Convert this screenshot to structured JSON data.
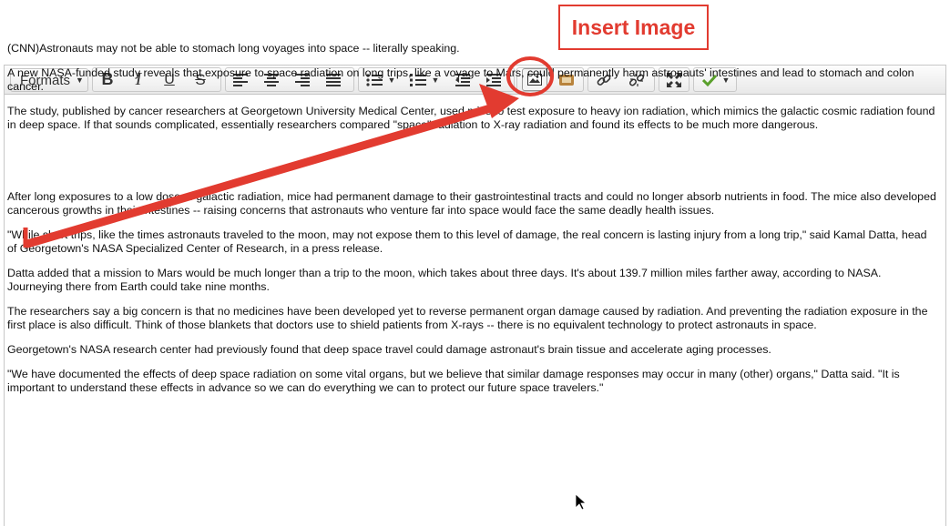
{
  "callout": {
    "label": "Insert Image"
  },
  "toolbar": {
    "formats_label": "Formats",
    "bold_label": "B",
    "italic_label": "I",
    "underline_label": "U",
    "strike_label": "S",
    "icons": [
      "align-left-icon",
      "align-center-icon",
      "align-right-icon",
      "align-justify-icon",
      "bullet-list-icon",
      "numbered-list-icon",
      "outdent-icon",
      "indent-icon",
      "insert-image-icon",
      "insert-media-icon",
      "link-icon",
      "unlink-icon",
      "fullscreen-icon",
      "check-icon"
    ]
  },
  "content": {
    "paragraphs": [
      "(CNN)Astronauts may not be able to stomach long voyages into space -- literally speaking.",
      "A new NASA-funded study reveals that exposure to space radiation on long trips, like a voyage to Mars, could permanently harm astronauts' intestines and lead to stomach and colon cancer.",
      "The study, published by cancer researchers at Georgetown University Medical Center, used mice to test exposure to heavy ion radiation, which mimics the galactic cosmic radiation found in deep space. If that sounds complicated, essentially researchers compared \"space\" radiation to X-ray radiation and found its effects to be much more dangerous.",
      "After long exposures to a low dose of galactic radiation, mice had permanent damage to their gastrointestinal tracts and could no longer absorb nutrients in food. The mice also developed cancerous growths in their intestines -- raising concerns that astronauts who venture far into space would face the same deadly health issues.",
      "\"While short trips, like the times astronauts traveled to the moon, may not expose them to this level of damage, the real concern is lasting injury from a long trip,\" said Kamal Datta, head of Georgetown's NASA Specialized Center of Research, in a press release.",
      "Datta added that a mission to Mars would be much longer than a trip to the moon, which takes about three days. It's about 139.7 million miles farther away, according to NASA. Journeying there from Earth could take nine months.",
      "The researchers say a big concern is that no medicines have been developed yet to reverse permanent organ damage caused by radiation. And preventing the radiation exposure in the first place is also difficult. Think of those blankets that doctors use to shield patients from X-rays -- there is no equivalent technology to protect astronauts in space.",
      "Georgetown's NASA research center had previously found that deep space travel could damage astronaut's brain tissue and accelerate aging processes.",
      "\"We have documented the effects of deep space radiation on some vital organs, but we believe that similar damage responses may occur in many (other) organs,\" Datta said. \"It is important to understand these effects in advance so we can do everything we can to protect our future space travelers.\""
    ]
  },
  "annotation": {
    "color": "#e23b30"
  }
}
